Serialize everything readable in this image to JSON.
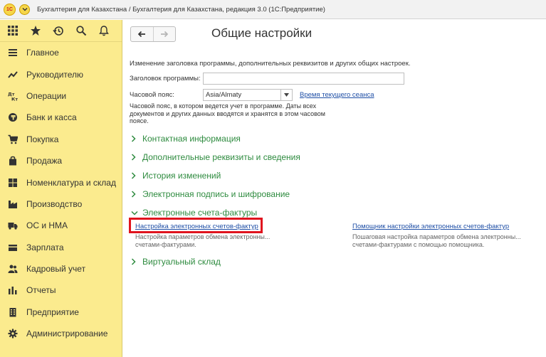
{
  "window": {
    "title": "Бухгалтерия для Казахстана / Бухгалтерия для Казахстана, редакция 3.0   (1С:Предприятие)",
    "logo_text": "1С"
  },
  "toolbar": {
    "icons": [
      "apps-grid-icon",
      "star-icon",
      "history-icon",
      "search-icon",
      "bell-icon"
    ]
  },
  "sidebar": {
    "items": [
      {
        "label": "Главное",
        "icon": "hamburger-icon"
      },
      {
        "label": "Руководителю",
        "icon": "trend-chart-icon"
      },
      {
        "label": "Операции",
        "icon": "dt-kt-icon"
      },
      {
        "label": "Банк и касса",
        "icon": "coin-icon"
      },
      {
        "label": "Покупка",
        "icon": "cart-icon"
      },
      {
        "label": "Продажа",
        "icon": "bag-icon"
      },
      {
        "label": "Номенклатура и склад",
        "icon": "grid-icon"
      },
      {
        "label": "Производство",
        "icon": "factory-icon"
      },
      {
        "label": "ОС и НМА",
        "icon": "truck-icon"
      },
      {
        "label": "Зарплата",
        "icon": "wallet-icon"
      },
      {
        "label": "Кадровый учет",
        "icon": "people-icon"
      },
      {
        "label": "Отчеты",
        "icon": "bar-chart-icon"
      },
      {
        "label": "Предприятие",
        "icon": "building-icon"
      },
      {
        "label": "Администрирование",
        "icon": "gear-icon"
      }
    ]
  },
  "main": {
    "title": "Общие настройки",
    "description": "Изменение заголовка программы, дополнительных реквизитов и других общих настроек.",
    "program_title_label": "Заголовок программы:",
    "program_title_value": "",
    "timezone_label": "Часовой пояс:",
    "timezone_value": "Asia/Almaty",
    "session_time_link": "Время текущего сеанса",
    "timezone_note": "Часовой пояс, в котором ведется учет в программе. Даты всех документов и других данных вводятся и хранятся в этом часовом поясе.",
    "sections": [
      {
        "label": "Контактная информация",
        "expanded": false
      },
      {
        "label": "Дополнительные реквизиты и сведения",
        "expanded": false
      },
      {
        "label": "История изменений",
        "expanded": false
      },
      {
        "label": "Электронная подпись и шифрование",
        "expanded": false
      },
      {
        "label": "Электронные счета-фактуры",
        "expanded": true
      },
      {
        "label": "Виртуальный склад",
        "expanded": false
      }
    ],
    "einvoice": {
      "settings_link": "Настройка электронных счетов-фактур",
      "settings_desc_1": "Настройка параметров обмена электронны...",
      "settings_desc_2": "счетами-фактурами.",
      "wizard_link": "Помощник настройки электронных счетов-фактур",
      "wizard_desc_1": "Пошаговая настройка параметров обмена электронны...",
      "wizard_desc_2": "счетами-фактурами с помощью помощника."
    }
  },
  "colors": {
    "sidebar_bg": "#fbeb8e",
    "section_green": "#2e8b3f",
    "link_blue": "#1f4fa6",
    "highlight_red": "#e0141e"
  }
}
